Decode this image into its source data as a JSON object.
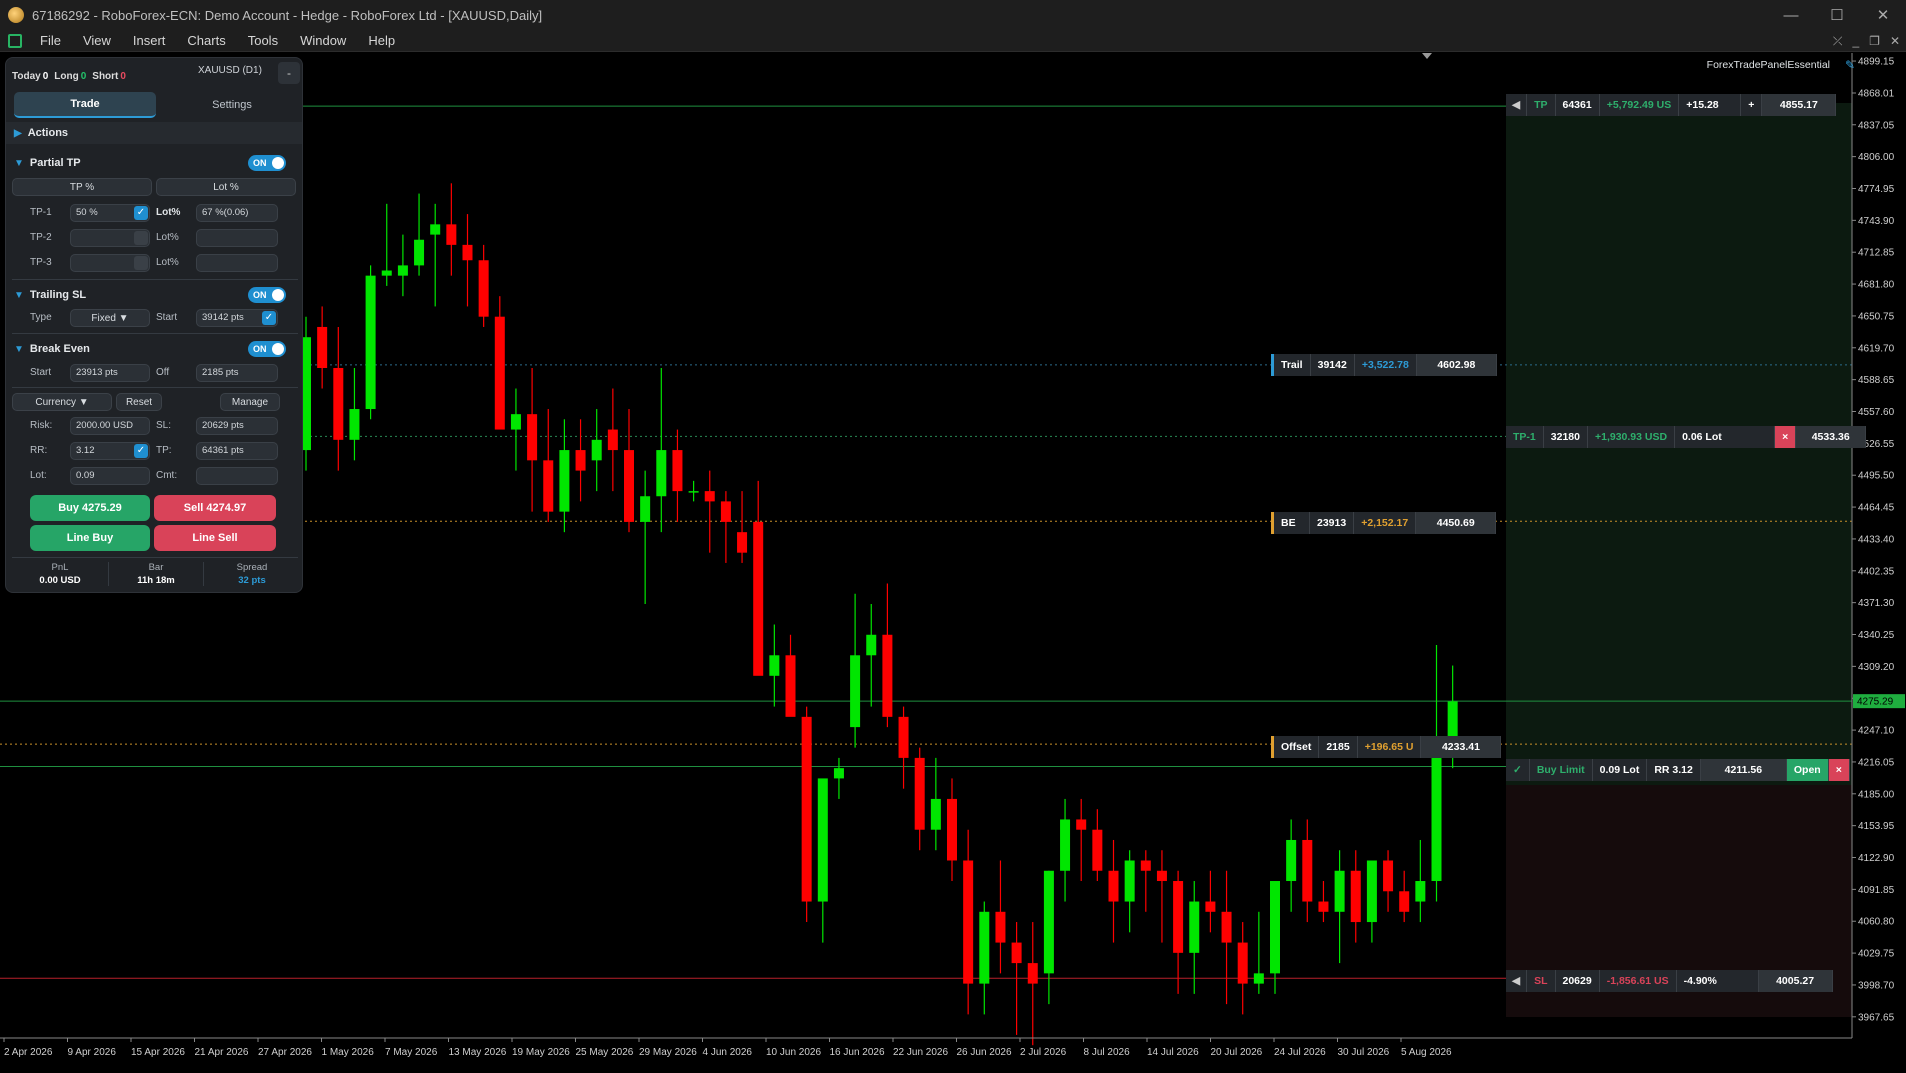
{
  "window": {
    "title": "67186292 - RoboForex-ECN: Demo Account - Hedge - RoboForex Ltd - [XAUUSD,Daily]",
    "min": "—",
    "max": "☐",
    "close": "✕"
  },
  "menu": [
    "File",
    "View",
    "Insert",
    "Charts",
    "Tools",
    "Window",
    "Help"
  ],
  "panel": {
    "today_label": "Today",
    "today_val": "0",
    "long_label": "Long",
    "long_val": "0",
    "short_label": "Short",
    "short_val": "0",
    "symbol": "XAUUSD (D1)",
    "minimize": "-",
    "tab_trade": "Trade",
    "tab_settings": "Settings",
    "actions": "Actions",
    "partial_tp": "Partial TP",
    "toggle_on": "ON",
    "tp_pct_btn": "TP %",
    "lot_pct_btn": "Lot %",
    "tp1": "TP-1",
    "tp2": "TP-2",
    "tp3": "TP-3",
    "tp1_val": "50 %",
    "lotpct_label": "Lot%",
    "tp1_lot": "67 %(0.06)",
    "trailing_sl": "Trailing SL",
    "type_label": "Type",
    "type_val": "Fixed ▼",
    "start_label": "Start",
    "trail_start": "39142 pts",
    "break_even": "Break Even",
    "be_start": "23913 pts",
    "off_label": "Off",
    "be_off": "2185 pts",
    "currency_btn": "Currency ▼",
    "reset_btn": "Reset",
    "manage_btn": "Manage",
    "risk_label": "Risk:",
    "risk_val": "2000.00  USD",
    "sl_label": "SL:",
    "sl_val": "20629  pts",
    "rr_label": "RR:",
    "rr_val": "3.12",
    "tp_label": "TP:",
    "tp_val": "64361  pts",
    "lot_label": "Lot:",
    "lot_val": "0.09",
    "cmt_label": "Cmt:",
    "buy_btn": "Buy  4275.29",
    "sell_btn": "Sell  4274.97",
    "line_buy": "Line Buy",
    "line_sell": "Line Sell",
    "pnl_k": "PnL",
    "pnl_v": "0.00 USD",
    "bar_k": "Bar",
    "bar_v": "11h 18m",
    "spread_k": "Spread",
    "spread_v": "32 pts"
  },
  "chart_overlays": {
    "brand": "ForexTradePanelEssential",
    "tp": {
      "name": "TP",
      "pts": "64361",
      "money": "+5,792.49 US",
      "pct": "+15.28",
      "plus": "+",
      "price": "4855.17"
    },
    "trail": {
      "name": "Trail",
      "pts": "39142",
      "money": "+3,522.78",
      "price": "4602.98"
    },
    "tp1": {
      "name": "TP-1",
      "pts": "32180",
      "money": "+1,930.93 USD",
      "lot": "0.06 Lot",
      "x": "×",
      "price": "4533.36"
    },
    "be": {
      "name": "BE",
      "pts": "23913",
      "money": "+2,152.17",
      "price": "4450.69"
    },
    "offset": {
      "name": "Offset",
      "pts": "2185",
      "money": "+196.65 U",
      "price": "4233.41"
    },
    "order": {
      "check": "✓",
      "name": "Buy Limit",
      "lot": "0.09 Lot",
      "rr": "RR 3.12",
      "price": "4211.56",
      "open": "Open",
      "x": "×"
    },
    "sl": {
      "name": "SL",
      "pts": "20629",
      "money": "-1,856.61 US",
      "pct": "-4.90%",
      "price": "4005.27"
    },
    "current_price_tag": "4275.29"
  },
  "colors": {
    "bull": "#00e600",
    "bear": "#ff0000",
    "grid_line_green": "#1f8f3f",
    "sl_line": "#b8202a",
    "be_line": "#c8902a"
  },
  "chart_data": {
    "type": "candlestick",
    "y_ticks": [
      "4899.15",
      "4868.01",
      "4837.05",
      "4806.00",
      "4774.95",
      "4743.90",
      "4712.85",
      "4681.80",
      "4650.75",
      "4619.70",
      "4588.65",
      "4557.60",
      "4526.55",
      "4495.50",
      "4464.45",
      "4433.40",
      "4402.35",
      "4371.30",
      "4340.25",
      "4309.20",
      "4278.15",
      "4247.10",
      "4216.05",
      "4185.00",
      "4153.95",
      "4122.90",
      "4091.85",
      "4060.80",
      "4029.75",
      "3998.70",
      "3967.65"
    ],
    "x_ticks": [
      "2 Apr 2026",
      "9 Apr 2026",
      "15 Apr 2026",
      "21 Apr 2026",
      "27 Apr 2026",
      "1 May 2026",
      "7 May 2026",
      "13 May 2026",
      "19 May 2026",
      "25 May 2026",
      "29 May 2026",
      "4 Jun 2026",
      "10 Jun 2026",
      "16 Jun 2026",
      "22 Jun 2026",
      "26 Jun 2026",
      "2 Jul 2026",
      "8 Jul 2026",
      "14 Jul 2026",
      "20 Jul 2026",
      "24 Jul 2026",
      "30 Jul 2026",
      "5 Aug 2026"
    ],
    "ylim": [
      3947,
      4907
    ],
    "candles": [
      [
        4520,
        4650,
        4500,
        4630
      ],
      [
        4640,
        4660,
        4580,
        4600
      ],
      [
        4600,
        4640,
        4500,
        4530
      ],
      [
        4530,
        4600,
        4510,
        4560
      ],
      [
        4560,
        4700,
        4550,
        4690
      ],
      [
        4690,
        4760,
        4680,
        4695
      ],
      [
        4690,
        4730,
        4670,
        4700
      ],
      [
        4700,
        4770,
        4690,
        4725
      ],
      [
        4730,
        4760,
        4660,
        4740
      ],
      [
        4740,
        4780,
        4690,
        4720
      ],
      [
        4720,
        4750,
        4660,
        4705
      ],
      [
        4705,
        4720,
        4640,
        4650
      ],
      [
        4650,
        4670,
        4550,
        4540
      ],
      [
        4540,
        4580,
        4500,
        4555
      ],
      [
        4555,
        4600,
        4460,
        4510
      ],
      [
        4510,
        4560,
        4450,
        4460
      ],
      [
        4460,
        4550,
        4440,
        4520
      ],
      [
        4520,
        4550,
        4470,
        4500
      ],
      [
        4510,
        4560,
        4480,
        4530
      ],
      [
        4540,
        4580,
        4480,
        4520
      ],
      [
        4520,
        4560,
        4440,
        4450
      ],
      [
        4450,
        4500,
        4370,
        4475
      ],
      [
        4475,
        4600,
        4440,
        4520
      ],
      [
        4520,
        4540,
        4450,
        4480
      ],
      [
        4480,
        4490,
        4470,
        4480
      ],
      [
        4480,
        4500,
        4420,
        4470
      ],
      [
        4470,
        4480,
        4410,
        4450
      ],
      [
        4440,
        4480,
        4410,
        4420
      ],
      [
        4450,
        4490,
        4330,
        4300
      ],
      [
        4300,
        4350,
        4270,
        4320
      ],
      [
        4320,
        4340,
        4270,
        4260
      ],
      [
        4260,
        4270,
        4060,
        4080
      ],
      [
        4080,
        4180,
        4040,
        4200
      ],
      [
        4200,
        4220,
        4180,
        4210
      ],
      [
        4250,
        4380,
        4230,
        4320
      ],
      [
        4320,
        4370,
        4270,
        4340
      ],
      [
        4340,
        4390,
        4250,
        4260
      ],
      [
        4260,
        4270,
        4190,
        4220
      ],
      [
        4220,
        4230,
        4130,
        4150
      ],
      [
        4150,
        4220,
        4130,
        4180
      ],
      [
        4180,
        4200,
        4100,
        4120
      ],
      [
        4120,
        4150,
        3970,
        4000
      ],
      [
        4000,
        4080,
        3970,
        4070
      ],
      [
        4070,
        4120,
        4010,
        4040
      ],
      [
        4040,
        4060,
        3950,
        4020
      ],
      [
        4020,
        4060,
        3940,
        4000
      ],
      [
        4010,
        4110,
        3980,
        4110
      ],
      [
        4110,
        4180,
        4080,
        4160
      ],
      [
        4160,
        4180,
        4100,
        4150
      ],
      [
        4150,
        4170,
        4100,
        4110
      ],
      [
        4110,
        4140,
        4040,
        4080
      ],
      [
        4080,
        4130,
        4050,
        4120
      ],
      [
        4120,
        4130,
        4070,
        4110
      ],
      [
        4110,
        4130,
        4040,
        4100
      ],
      [
        4100,
        4110,
        3990,
        4030
      ],
      [
        4030,
        4100,
        3990,
        4080
      ],
      [
        4080,
        4110,
        4050,
        4070
      ],
      [
        4070,
        4110,
        3980,
        4040
      ],
      [
        4040,
        4060,
        3970,
        4000
      ],
      [
        4000,
        4070,
        3990,
        4010
      ],
      [
        4010,
        4080,
        3990,
        4100
      ],
      [
        4100,
        4160,
        4070,
        4140
      ],
      [
        4140,
        4160,
        4060,
        4080
      ],
      [
        4080,
        4100,
        4060,
        4070
      ],
      [
        4070,
        4130,
        4020,
        4110
      ],
      [
        4110,
        4130,
        4040,
        4060
      ],
      [
        4060,
        4120,
        4040,
        4120
      ],
      [
        4120,
        4130,
        4070,
        4090
      ],
      [
        4090,
        4110,
        4060,
        4070
      ],
      [
        4080,
        4140,
        4060,
        4100
      ],
      [
        4100,
        4330,
        4080,
        4230
      ],
      [
        4230,
        4310,
        4210,
        4275
      ]
    ]
  }
}
